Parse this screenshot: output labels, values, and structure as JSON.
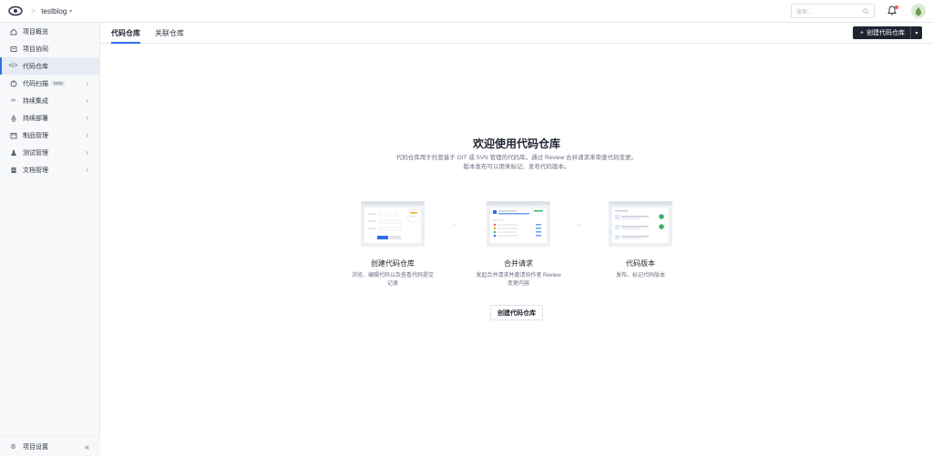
{
  "header": {
    "project_name": "testblog",
    "search_placeholder": "搜索..."
  },
  "sidebar": {
    "items": [
      {
        "label": "项目概览",
        "icon": "home-icon",
        "has_chevron": false
      },
      {
        "label": "项目协同",
        "icon": "board-icon",
        "has_chevron": false
      },
      {
        "label": "代码仓库",
        "icon": "code-icon",
        "has_chevron": false,
        "active": true
      },
      {
        "label": "代码扫描",
        "icon": "scan-icon",
        "has_chevron": true,
        "badge": "beta"
      },
      {
        "label": "持续集成",
        "icon": "infinity-icon",
        "has_chevron": true
      },
      {
        "label": "持续部署",
        "icon": "rocket-icon",
        "has_chevron": true
      },
      {
        "label": "制品管理",
        "icon": "package-icon",
        "has_chevron": true
      },
      {
        "label": "测试管理",
        "icon": "flask-icon",
        "has_chevron": true
      },
      {
        "label": "文档管理",
        "icon": "docs-icon",
        "has_chevron": true
      }
    ],
    "settings_label": "项目设置",
    "collapse_glyph": "«"
  },
  "tabs": [
    {
      "label": "代码仓库",
      "active": true
    },
    {
      "label": "关联仓库",
      "active": false
    }
  ],
  "create_button": {
    "label": "创建代码仓库",
    "plus": "+"
  },
  "welcome": {
    "title": "欢迎使用代码仓库",
    "desc_line1": "代码仓库用于托管基于 GIT 或 SVN 管理的代码库。通过 Review 合并请求来审查代码变更。",
    "desc_line2": "版本发布可以用来标记、发布代码版本。"
  },
  "cards": [
    {
      "title": "创建代码仓库",
      "desc_line1": "浏览、编辑代码以及查看代码提交",
      "desc_line2": "记录"
    },
    {
      "title": "合并请求",
      "desc_line1": "发起合并请求并邀请协作者 Review",
      "desc_line2": "变更内容"
    },
    {
      "title": "代码版本",
      "desc_line1": "发布、标记代码版本",
      "desc_line2": ""
    }
  ],
  "arrow_glyph": "→",
  "bottom_button_label": "创建代码仓库",
  "colors": {
    "accent": "#2f6fea",
    "primary_button": "#1f2430",
    "sidebar_bg": "#f7f8fa"
  }
}
